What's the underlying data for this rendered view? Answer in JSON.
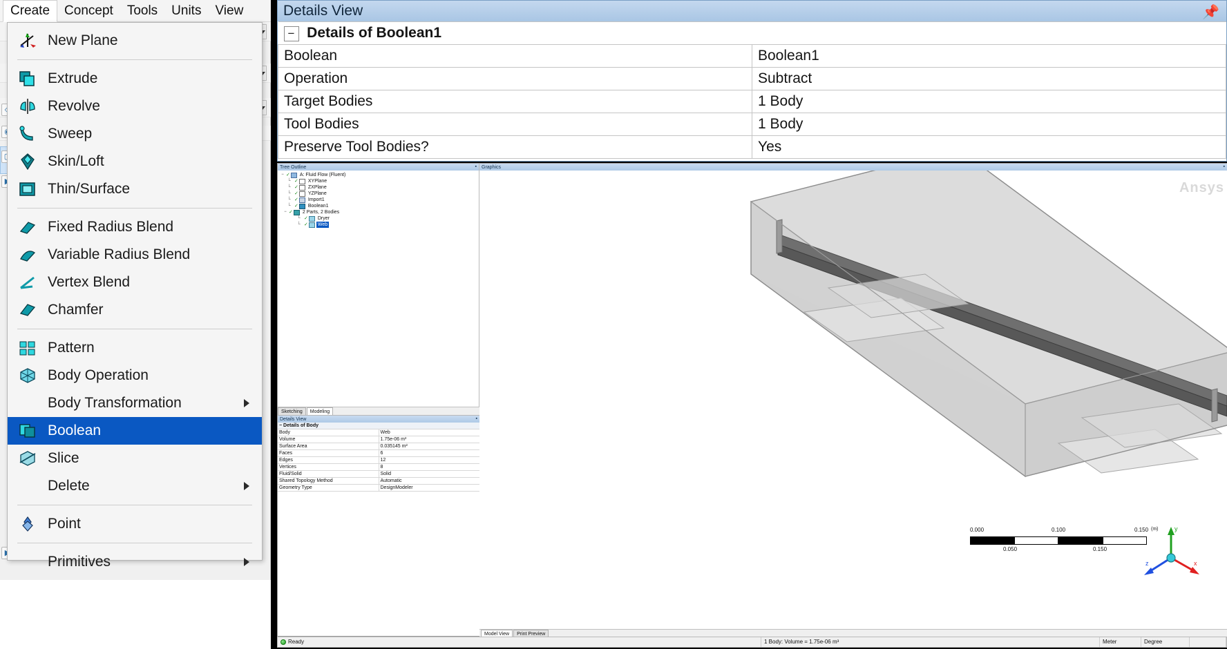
{
  "menubar": {
    "items": [
      {
        "label": "Create",
        "active": true
      },
      {
        "label": "Concept",
        "active": false
      },
      {
        "label": "Tools",
        "active": false
      },
      {
        "label": "Units",
        "active": false
      },
      {
        "label": "View",
        "active": false
      }
    ]
  },
  "create_menu": {
    "items": [
      {
        "label": "New Plane",
        "icon": "plane-icon",
        "selected": false,
        "submenu": false,
        "sep_after": true
      },
      {
        "label": "Extrude",
        "icon": "extrude-icon",
        "selected": false,
        "submenu": false
      },
      {
        "label": "Revolve",
        "icon": "revolve-icon",
        "selected": false,
        "submenu": false
      },
      {
        "label": "Sweep",
        "icon": "sweep-icon",
        "selected": false,
        "submenu": false
      },
      {
        "label": "Skin/Loft",
        "icon": "skin-loft-icon",
        "selected": false,
        "submenu": false
      },
      {
        "label": "Thin/Surface",
        "icon": "thin-surface-icon",
        "selected": false,
        "submenu": false,
        "sep_after": true
      },
      {
        "label": "Fixed Radius Blend",
        "icon": "fixed-radius-blend-icon",
        "selected": false,
        "submenu": false
      },
      {
        "label": "Variable Radius Blend",
        "icon": "variable-radius-blend-icon",
        "selected": false,
        "submenu": false
      },
      {
        "label": "Vertex Blend",
        "icon": "vertex-blend-icon",
        "selected": false,
        "submenu": false
      },
      {
        "label": "Chamfer",
        "icon": "chamfer-icon",
        "selected": false,
        "submenu": false,
        "sep_after": true
      },
      {
        "label": "Pattern",
        "icon": "pattern-icon",
        "selected": false,
        "submenu": false
      },
      {
        "label": "Body Operation",
        "icon": "body-operation-icon",
        "selected": false,
        "submenu": false
      },
      {
        "label": "Body Transformation",
        "icon": "none",
        "selected": false,
        "submenu": true
      },
      {
        "label": "Boolean",
        "icon": "boolean-icon",
        "selected": true,
        "submenu": false
      },
      {
        "label": "Slice",
        "icon": "slice-icon",
        "selected": false,
        "submenu": false
      },
      {
        "label": "Delete",
        "icon": "none",
        "selected": false,
        "submenu": true,
        "sep_after": true
      },
      {
        "label": "Point",
        "icon": "point-icon",
        "selected": false,
        "submenu": false,
        "sep_after": true
      },
      {
        "label": "Primitives",
        "icon": "none",
        "selected": false,
        "submenu": true
      }
    ]
  },
  "details_view": {
    "title": "Details View",
    "pin_icon": "pin-icon",
    "section_header": "Details of Boolean1",
    "expander": "−",
    "rows": [
      {
        "property": "Boolean",
        "value": "Boolean1"
      },
      {
        "property": "Operation",
        "value": "Subtract"
      },
      {
        "property": "Target Bodies",
        "value": "1 Body"
      },
      {
        "property": "Tool Bodies",
        "value": "1 Body"
      },
      {
        "property": "Preserve Tool Bodies?",
        "value": "Yes"
      }
    ]
  },
  "tree_outline": {
    "title": "Tree Outline",
    "nodes": [
      {
        "label": "A: Fluid Flow (Fluent)",
        "depth": 0,
        "icon": "project-icon",
        "expander": "−",
        "selected": false
      },
      {
        "label": "XYPlane",
        "depth": 1,
        "icon": "plane-icon",
        "expander": "",
        "selected": false
      },
      {
        "label": "ZXPlane",
        "depth": 1,
        "icon": "plane-icon",
        "expander": "",
        "selected": false
      },
      {
        "label": "YZPlane",
        "depth": 1,
        "icon": "plane-icon",
        "expander": "",
        "selected": false
      },
      {
        "label": "Import1",
        "depth": 1,
        "icon": "import-icon",
        "expander": "",
        "selected": false
      },
      {
        "label": "Boolean1",
        "depth": 1,
        "icon": "boolean-icon",
        "expander": "",
        "selected": false
      },
      {
        "label": "2 Parts, 2 Bodies",
        "depth": 1,
        "icon": "parts-icon",
        "expander": "−",
        "selected": false
      },
      {
        "label": "Dryer",
        "depth": 2,
        "icon": "body-icon",
        "expander": "",
        "selected": false
      },
      {
        "label": "Web",
        "depth": 2,
        "icon": "body-icon",
        "expander": "",
        "selected": true
      }
    ]
  },
  "sketch_tabs": {
    "items": [
      {
        "label": "Sketching",
        "active": false
      },
      {
        "label": "Modeling",
        "active": true
      }
    ]
  },
  "body_details": {
    "title": "Details View",
    "section_header": "Details of Body",
    "expander": "−",
    "rows": [
      {
        "property": "Body",
        "value": "Web"
      },
      {
        "property": "Volume",
        "value": "1.75e-06 m³"
      },
      {
        "property": "Surface Area",
        "value": "0.035145 m²"
      },
      {
        "property": "Faces",
        "value": "6"
      },
      {
        "property": "Edges",
        "value": "12"
      },
      {
        "property": "Vertices",
        "value": "8"
      },
      {
        "property": "Fluid/Solid",
        "value": "Solid"
      },
      {
        "property": "Shared Topology Method",
        "value": "Automatic"
      },
      {
        "property": "Geometry Type",
        "value": "DesignModeler"
      }
    ]
  },
  "graphics": {
    "title": "Graphics",
    "watermark": "Ansys",
    "scalebar": {
      "left_label": "0.000",
      "right_label": "0.100",
      "mid_label_low": "0.050",
      "mid_label_high": "0.150",
      "unit": "(m)"
    },
    "view_tabs": [
      {
        "label": "Model View",
        "active": true
      },
      {
        "label": "Print Preview",
        "active": false
      }
    ],
    "triad": {
      "x_label": "x",
      "y_label": "y",
      "z_label": "z",
      "x_color": "#e02020",
      "y_color": "#20a020",
      "z_color": "#2050e0"
    }
  },
  "statusbar": {
    "ready_label": "Ready",
    "ready_icon": "status-ok-icon",
    "selection_info": "1 Body: Volume = 1.75e-06 m³",
    "unit_length": "Meter",
    "unit_angle": "Degree"
  }
}
